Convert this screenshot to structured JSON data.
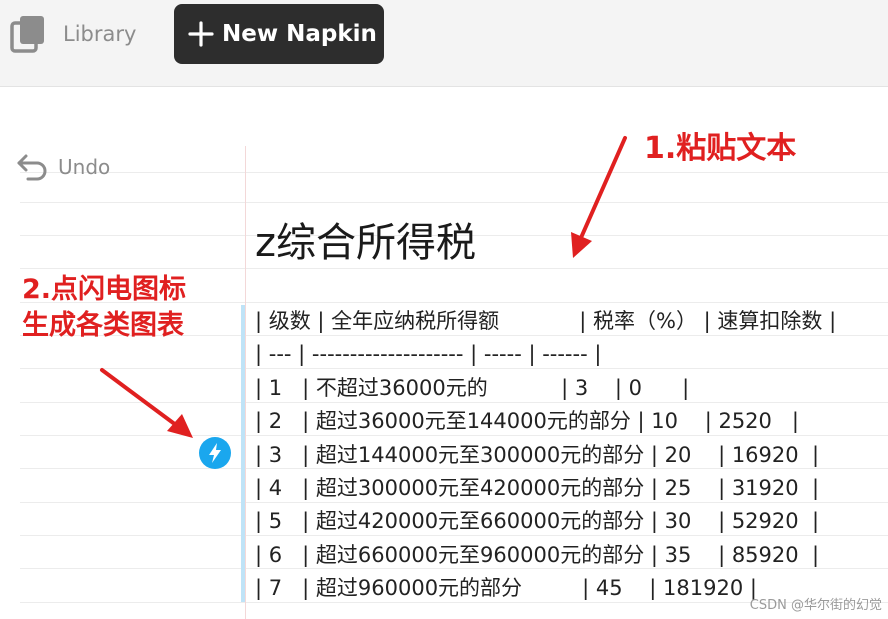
{
  "topbar": {
    "library_label": "Library",
    "new_napkin_label": "New Napkin"
  },
  "icons": {
    "library": "library-icon",
    "plus": "plus-icon",
    "undo": "undo-icon",
    "bolt": "lightning-bolt-icon"
  },
  "undo": {
    "label": "Undo"
  },
  "document": {
    "title": "z综合所得税",
    "rows": [
      "| 级数 | 全年应纳税所得额            | 税率（%） | 速算扣除数 |",
      "| --- | -------------------- | ----- | ------ |",
      "| 1   | 不超过36000元的           | 3    | 0      |",
      "| 2   | 超过36000元至144000元的部分 | 10    | 2520   |",
      "| 3   | 超过144000元至300000元的部分 | 20    | 16920  |",
      "| 4   | 超过300000元至420000元的部分 | 25    | 31920  |",
      "| 5   | 超过420000元至660000元的部分 | 30    | 52920  |",
      "| 6   | 超过660000元至960000元的部分 | 35    | 85920  |",
      "| 7   | 超过960000元的部分         | 45    | 181920 |"
    ]
  },
  "annotations": {
    "step1": "1.粘贴文本",
    "step2_line1": "2.点闪电图标",
    "step2_line2": "生成各类图表"
  },
  "watermark": "CSDN @华尔街的幻觉",
  "colors": {
    "topbar_bg": "#f4f4f4",
    "button_dark": "#2d2d2d",
    "annotation_red": "#e02020",
    "bolt_blue": "#1aa7ee",
    "selection_blue": "#bfe3f7"
  }
}
